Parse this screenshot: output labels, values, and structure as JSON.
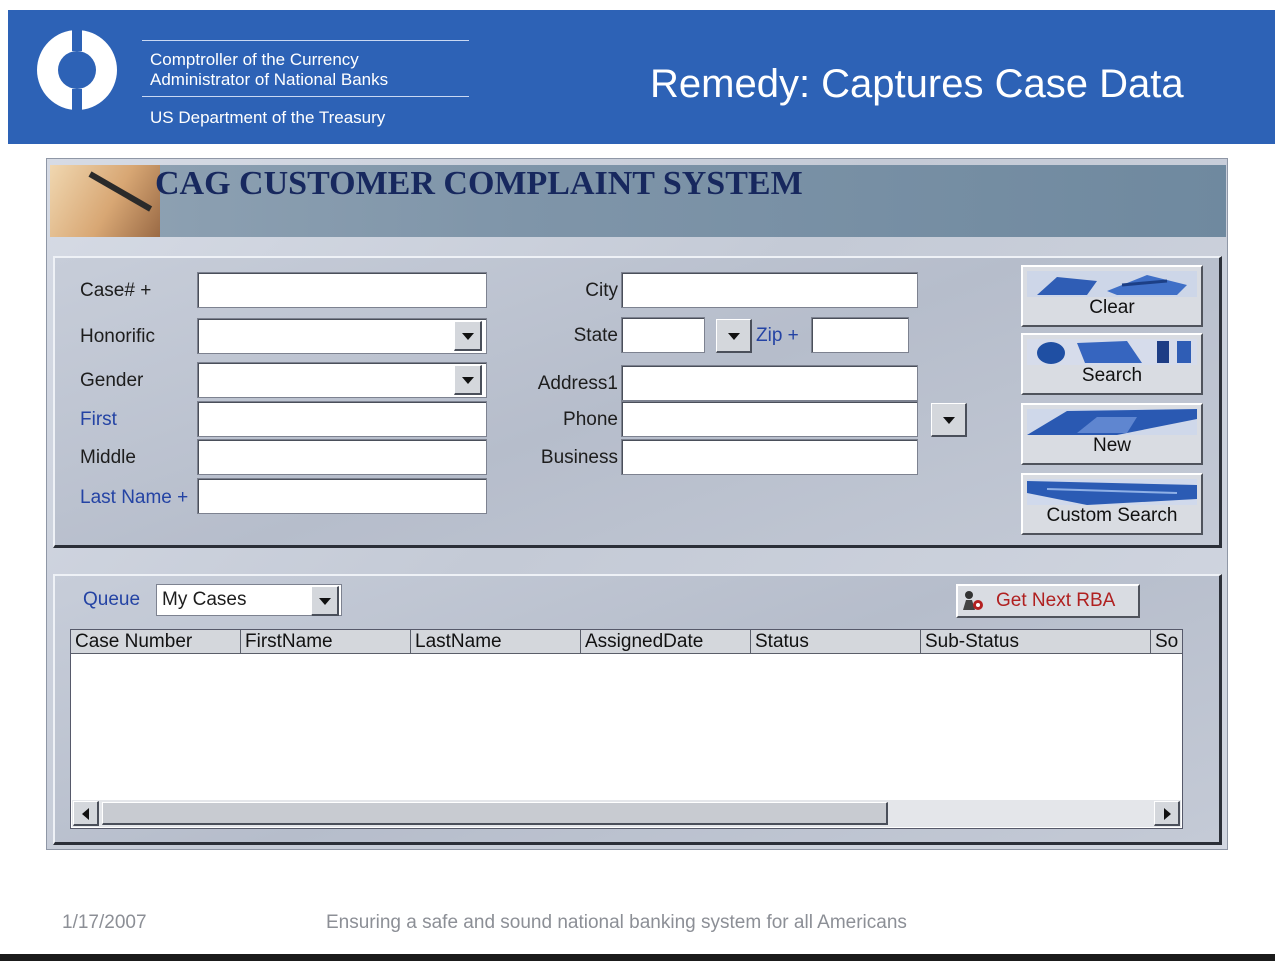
{
  "header": {
    "org_line1": "Comptroller of the Currency",
    "org_line2": "Administrator of National Banks",
    "org_line3": "US Department of the Treasury",
    "title": "Remedy: Captures Case Data"
  },
  "app": {
    "banner_title": "CAG CUSTOMER COMPLAINT SYSTEM",
    "form": {
      "case_label": "Case# +",
      "honorific_label": "Honorific",
      "gender_label": "Gender",
      "first_label": "First",
      "middle_label": "Middle",
      "last_name_label": "Last Name +",
      "city_label": "City",
      "state_label": "State",
      "zip_label": "Zip +",
      "address1_label": "Address1",
      "phone_label": "Phone",
      "business_label": "Business"
    },
    "buttons": {
      "clear": "Clear",
      "search": "Search",
      "new": "New",
      "custom_search": "Custom Search"
    },
    "queue": {
      "label": "Queue",
      "selected": "My Cases",
      "get_next_rba": "Get Next RBA"
    },
    "table": {
      "columns": [
        "Case Number",
        "FirstName",
        "LastName",
        "AssignedDate",
        "Status",
        "Sub-Status",
        "So"
      ],
      "rows": []
    }
  },
  "footer": {
    "date": "1/17/2007",
    "tagline": "Ensuring a safe and sound national banking system for all Americans"
  }
}
